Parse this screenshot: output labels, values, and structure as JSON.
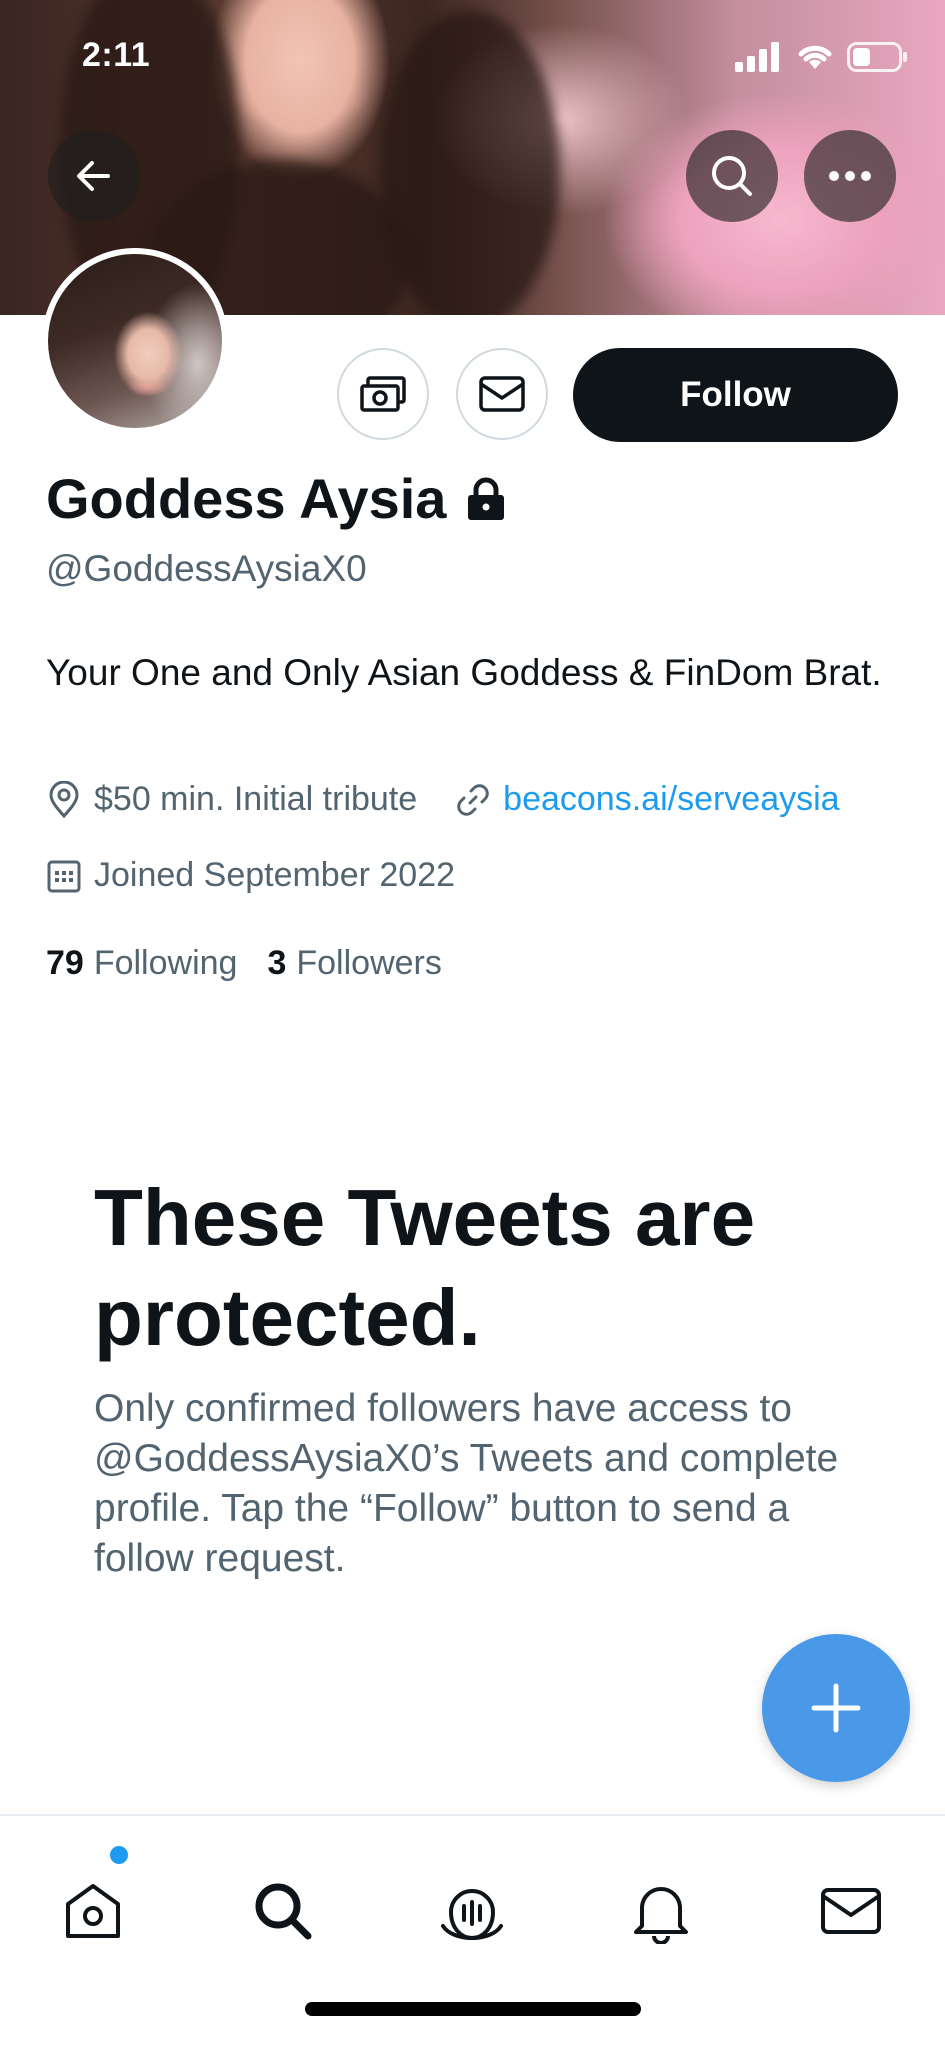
{
  "status_bar": {
    "time": "2:11"
  },
  "profile": {
    "display_name": "Goddess Aysia",
    "handle": "@GoddessAysiaX0",
    "bio": "Your One and Only Asian Goddess & FinDom Brat.",
    "location": "$50 min. Initial tribute",
    "website": "beacons.ai/serveaysia",
    "joined": "Joined September 2022",
    "following_count": "79",
    "following_label": "Following",
    "followers_count": "3",
    "followers_label": "Followers"
  },
  "actions": {
    "follow_label": "Follow"
  },
  "protected": {
    "title": "These Tweets are protected.",
    "body": "Only confirmed followers have access to @GoddessAysiaX0’s Tweets and complete profile. Tap the “Follow” button to send a follow request."
  },
  "colors": {
    "accent": "#1d9bf0",
    "text": "#0f1419",
    "muted": "#536471",
    "fab": "#4a99e9"
  },
  "tabs": [
    "home-icon",
    "search-icon",
    "spaces-icon",
    "notifications-icon",
    "messages-icon"
  ]
}
